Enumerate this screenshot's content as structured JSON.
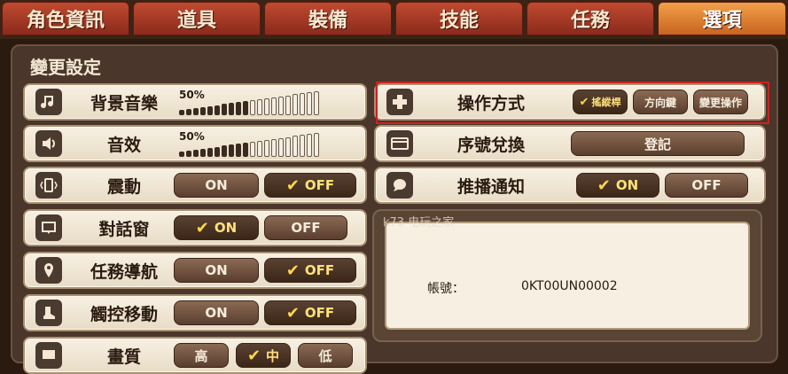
{
  "tabs": [
    "角色資訊",
    "道具",
    "裝備",
    "技能",
    "任務",
    "選項"
  ],
  "panel_title": "變更設定",
  "left_rows": [
    {
      "label": "背景音樂",
      "icon": "music-icon",
      "type": "volume",
      "percent": "50%",
      "level": 0.5
    },
    {
      "label": "音效",
      "icon": "speaker-icon",
      "type": "volume",
      "percent": "50%",
      "level": 0.5
    },
    {
      "label": "震動",
      "icon": "vibration-icon",
      "type": "toggle",
      "on": "ON",
      "off": "OFF",
      "selected": "OFF"
    },
    {
      "label": "對話窗",
      "icon": "chat-window-icon",
      "type": "toggle",
      "on": "ON",
      "off": "OFF",
      "selected": "ON"
    },
    {
      "label": "任務導航",
      "icon": "map-pin-icon",
      "type": "toggle",
      "on": "ON",
      "off": "OFF",
      "selected": "OFF"
    },
    {
      "label": "觸控移動",
      "icon": "boot-icon",
      "type": "toggle",
      "on": "ON",
      "off": "OFF",
      "selected": "OFF"
    },
    {
      "label": "畫質",
      "icon": "display-icon",
      "type": "triple",
      "options": [
        "高",
        "中",
        "低"
      ],
      "selected": "中"
    }
  ],
  "right_rows": {
    "control": {
      "label": "操作方式",
      "options": [
        "搖縱桿",
        "方向鍵",
        "變更操作"
      ],
      "selected": "搖縱桿"
    },
    "serial": {
      "label": "序號兌換",
      "button": "登記"
    },
    "push": {
      "label": "推播通知",
      "on": "ON",
      "off": "OFF",
      "selected": "ON"
    }
  },
  "account": {
    "key": "帳號：",
    "value": "0KT00UN00002"
  },
  "watermark": "k73 电玩之家",
  "colors": {
    "active_tab": "#e8883a",
    "tab": "#a83a26",
    "panel": "#4a362a",
    "highlight": "#d02020"
  }
}
